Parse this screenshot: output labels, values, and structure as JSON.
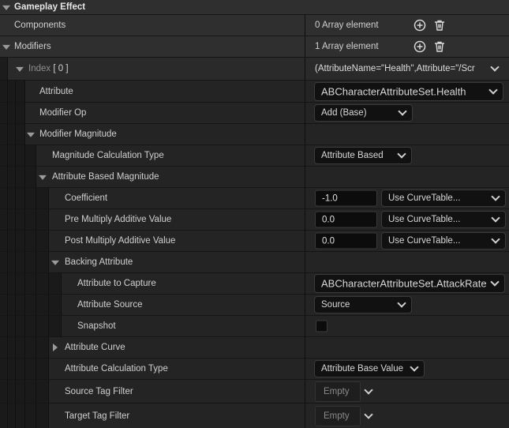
{
  "section": {
    "title": "Gameplay Effect"
  },
  "components": {
    "label": "Components",
    "value": "0 Array element"
  },
  "modifiers": {
    "label": "Modifiers",
    "value": "1 Array element"
  },
  "index": {
    "label": "Index",
    "number": "[ 0 ]",
    "value": "(AttributeName=\"Health\",Attribute=\"/Scr"
  },
  "attribute": {
    "label": "Attribute",
    "value": "ABCharacterAttributeSet.Health"
  },
  "modifier_op": {
    "label": "Modifier Op",
    "value": "Add (Base)"
  },
  "modifier_magnitude": {
    "label": "Modifier Magnitude"
  },
  "magnitude_calc_type": {
    "label": "Magnitude Calculation Type",
    "value": "Attribute Based"
  },
  "attribute_based_magnitude": {
    "label": "Attribute Based Magnitude"
  },
  "coefficient": {
    "label": "Coefficient",
    "value": "-1.0",
    "curve": "Use CurveTable..."
  },
  "pre_multiply": {
    "label": "Pre Multiply Additive Value",
    "value": "0.0",
    "curve": "Use CurveTable..."
  },
  "post_multiply": {
    "label": "Post Multiply Additive Value",
    "value": "0.0",
    "curve": "Use CurveTable..."
  },
  "backing_attribute": {
    "label": "Backing Attribute"
  },
  "attribute_to_capture": {
    "label": "Attribute to Capture",
    "value": "ABCharacterAttributeSet.AttackRate"
  },
  "attribute_source": {
    "label": "Attribute Source",
    "value": "Source"
  },
  "snapshot": {
    "label": "Snapshot",
    "checked": false
  },
  "attribute_curve": {
    "label": "Attribute Curve"
  },
  "attribute_calc_type": {
    "label": "Attribute Calculation Type",
    "value": "Attribute Base Value"
  },
  "source_tag_filter": {
    "label": "Source Tag Filter",
    "value": "Empty"
  },
  "target_tag_filter": {
    "label": "Target Tag Filter",
    "value": "Empty"
  }
}
